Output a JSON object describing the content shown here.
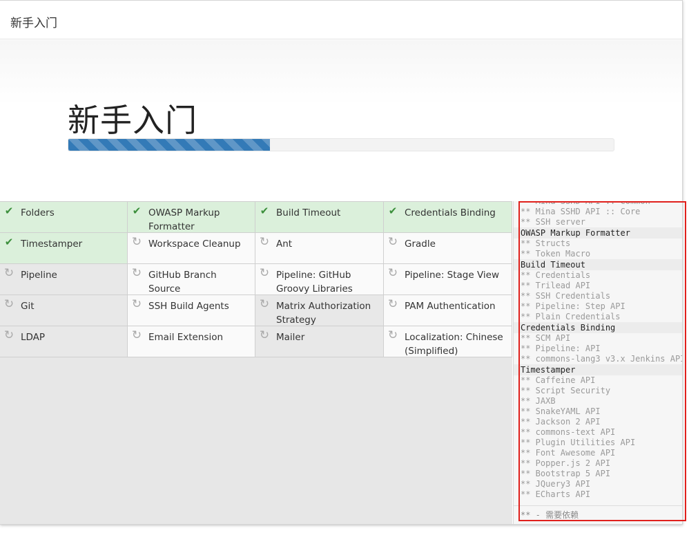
{
  "dialog": {
    "title": "新手入门"
  },
  "hero": {
    "title": "新手入门",
    "progress_percent": 37
  },
  "plugins": [
    {
      "label": "Folders",
      "state": "done"
    },
    {
      "label": "OWASP Markup Formatter",
      "state": "done"
    },
    {
      "label": "Build Timeout",
      "state": "done"
    },
    {
      "label": "Credentials Binding",
      "state": "done"
    },
    {
      "label": "Timestamper",
      "state": "done"
    },
    {
      "label": "Workspace Cleanup",
      "state": "pending"
    },
    {
      "label": "Ant",
      "state": "pending"
    },
    {
      "label": "Gradle",
      "state": "pending"
    },
    {
      "label": "Pipeline",
      "state": "installing"
    },
    {
      "label": "GitHub Branch Source",
      "state": "pending"
    },
    {
      "label": "Pipeline: GitHub Groovy Libraries",
      "state": "pending"
    },
    {
      "label": "Pipeline: Stage View",
      "state": "pending"
    },
    {
      "label": "Git",
      "state": "installing"
    },
    {
      "label": "SSH Build Agents",
      "state": "pending"
    },
    {
      "label": "Matrix Authorization Strategy",
      "state": "installing"
    },
    {
      "label": "PAM Authentication",
      "state": "pending"
    },
    {
      "label": "LDAP",
      "state": "installing"
    },
    {
      "label": "Email Extension",
      "state": "pending"
    },
    {
      "label": "Mailer",
      "state": "installing"
    },
    {
      "label": "Localization: Chinese (Simplified)",
      "state": "pending"
    }
  ],
  "log": {
    "lines": [
      {
        "text": "** Mina SSHD API :: Common",
        "head": false
      },
      {
        "text": "** Mina SSHD API :: Core",
        "head": false
      },
      {
        "text": "** SSH server",
        "head": false
      },
      {
        "text": "OWASP Markup Formatter",
        "head": true
      },
      {
        "text": "** Structs",
        "head": false
      },
      {
        "text": "** Token Macro",
        "head": false
      },
      {
        "text": "Build Timeout",
        "head": true
      },
      {
        "text": "** Credentials",
        "head": false
      },
      {
        "text": "** Trilead API",
        "head": false
      },
      {
        "text": "** SSH Credentials",
        "head": false
      },
      {
        "text": "** Pipeline: Step API",
        "head": false
      },
      {
        "text": "** Plain Credentials",
        "head": false
      },
      {
        "text": "Credentials Binding",
        "head": true
      },
      {
        "text": "** SCM API",
        "head": false
      },
      {
        "text": "** Pipeline: API",
        "head": false
      },
      {
        "text": "** commons-lang3 v3.x Jenkins API",
        "head": false
      },
      {
        "text": "Timestamper",
        "head": true
      },
      {
        "text": "** Caffeine API",
        "head": false
      },
      {
        "text": "** Script Security",
        "head": false
      },
      {
        "text": "** JAXB",
        "head": false
      },
      {
        "text": "** SnakeYAML API",
        "head": false
      },
      {
        "text": "** Jackson 2 API",
        "head": false
      },
      {
        "text": "** commons-text API",
        "head": false
      },
      {
        "text": "** Plugin Utilities API",
        "head": false
      },
      {
        "text": "** Font Awesome API",
        "head": false
      },
      {
        "text": "** Popper.js 2 API",
        "head": false
      },
      {
        "text": "** Bootstrap 5 API",
        "head": false
      },
      {
        "text": "** JQuery3 API",
        "head": false
      },
      {
        "text": "** ECharts API",
        "head": false
      }
    ],
    "footer": "** - 需要依赖"
  },
  "colors": {
    "done": "#dbf0db",
    "installing": "#e8e8e8",
    "pending": "#fafafa",
    "check": "#3c8f3c",
    "progress": "#337ab7",
    "highlight": "#e0201c"
  },
  "icons": {
    "done": "check-icon",
    "waiting": "refresh-icon"
  }
}
